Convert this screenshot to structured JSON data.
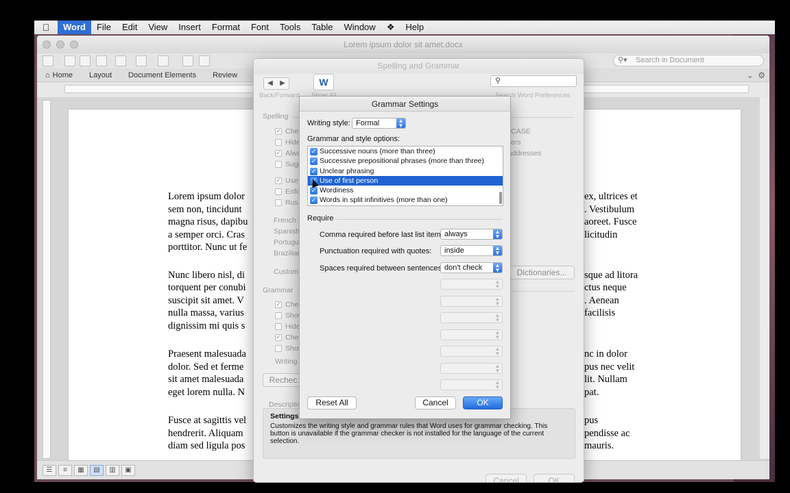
{
  "menubar": {
    "items": [
      "Word",
      "File",
      "Edit",
      "View",
      "Insert",
      "Format",
      "Font",
      "Tools",
      "Table",
      "Window",
      "Help"
    ]
  },
  "word_window": {
    "doc_title": "Lorem ipsum dolor sit amet.docx",
    "search_placeholder": "Search in Document",
    "ribbon_tabs": [
      "Home",
      "Layout",
      "Document Elements",
      "Review"
    ]
  },
  "document": {
    "lines": [
      [
        "Lorem ipsum dolor",
        "ex, ultrices et"
      ],
      [
        "sem non, tincidunt",
        ". Vestibulum"
      ],
      [
        "magna risus, dapibu",
        "aoreet. Fusce"
      ],
      [
        "a semper orci. Cras",
        "licitudin"
      ],
      [
        "porttitor. Nunc ut fe",
        ""
      ],
      [
        "Nunc libero nisl, di",
        "sque ad litora"
      ],
      [
        "torquent per conubi",
        "ctus neque"
      ],
      [
        "suscipit sit amet. V",
        ". Aenean"
      ],
      [
        "nulla massa, varius",
        "facilisis"
      ],
      [
        "dignissim mi quis s",
        ""
      ],
      [
        "Praesent malesuada",
        "nc in dolor"
      ],
      [
        "dolor. Sed et ferme",
        "pus nec velit"
      ],
      [
        "sit amet malesuada",
        "lit. Nullam"
      ],
      [
        "eget lorem nulla. N",
        "pat."
      ],
      [
        "Fusce at sagittis vel",
        "pus"
      ],
      [
        "hendrerit. Aliquam",
        "pendisse ac"
      ],
      [
        "diam sed ligula pos",
        "mauris."
      ]
    ]
  },
  "spelling_grammar": {
    "title": "Spelling and Grammar",
    "back_forward": "Back/Forward",
    "show_all": "Show All",
    "search_prefs_label": "Search Word Preferences",
    "spelling_section": "Spelling",
    "spelling_items": [
      "Chec",
      "Hide",
      "Alwa",
      "Sugg",
      "Use",
      "Enfo",
      "Rus"
    ],
    "right_items": [
      "CASE",
      "bers",
      "addresses"
    ],
    "languages": [
      "French",
      "Spanish",
      "Portugu",
      "Brazilian"
    ],
    "custom": "Custom",
    "dictionaries_button": "Dictionaries...",
    "grammar_section": "Grammar",
    "grammar_items": [
      "Chec",
      "Show",
      "Hide",
      "Chec",
      "Show"
    ],
    "writing_style_short": "Writing s",
    "recheck_button": "Rechec",
    "description_label": "Descriptio",
    "description_title": "Settings",
    "description_text": "Customizes the writing style and grammar rules that Word uses for grammar checking. This button is unavailable if the grammar checker is not installed for the language of the current selection.",
    "cancel_button": "Cancel",
    "ok_button": "OK"
  },
  "grammar_settings": {
    "title": "Grammar Settings",
    "writing_style_label": "Writing style:",
    "writing_style_value": "Formal",
    "options_label": "Grammar and style options:",
    "options": [
      {
        "label": "Successive nouns (more than three)",
        "checked": true,
        "selected": false
      },
      {
        "label": "Successive prepositional phrases (more than three)",
        "checked": true,
        "selected": false
      },
      {
        "label": "Unclear phrasing",
        "checked": true,
        "selected": false
      },
      {
        "label": "Use of first person",
        "checked": true,
        "selected": true
      },
      {
        "label": "Wordiness",
        "checked": true,
        "selected": false
      },
      {
        "label": "Words in split infinitives (more than one)",
        "checked": true,
        "selected": false
      }
    ],
    "require_label": "Require",
    "requirements": [
      {
        "label": "Comma required before last list item:",
        "value": "always"
      },
      {
        "label": "Punctuation required with quotes:",
        "value": "inside"
      },
      {
        "label": "Spaces required between sentences:",
        "value": "don't check"
      }
    ],
    "reset_button": "Reset All",
    "cancel_button": "Cancel",
    "ok_button": "OK"
  },
  "colors": {
    "accent": "#2f6fd6",
    "selection": "#1f63d3",
    "spell_underline": "#d33"
  }
}
